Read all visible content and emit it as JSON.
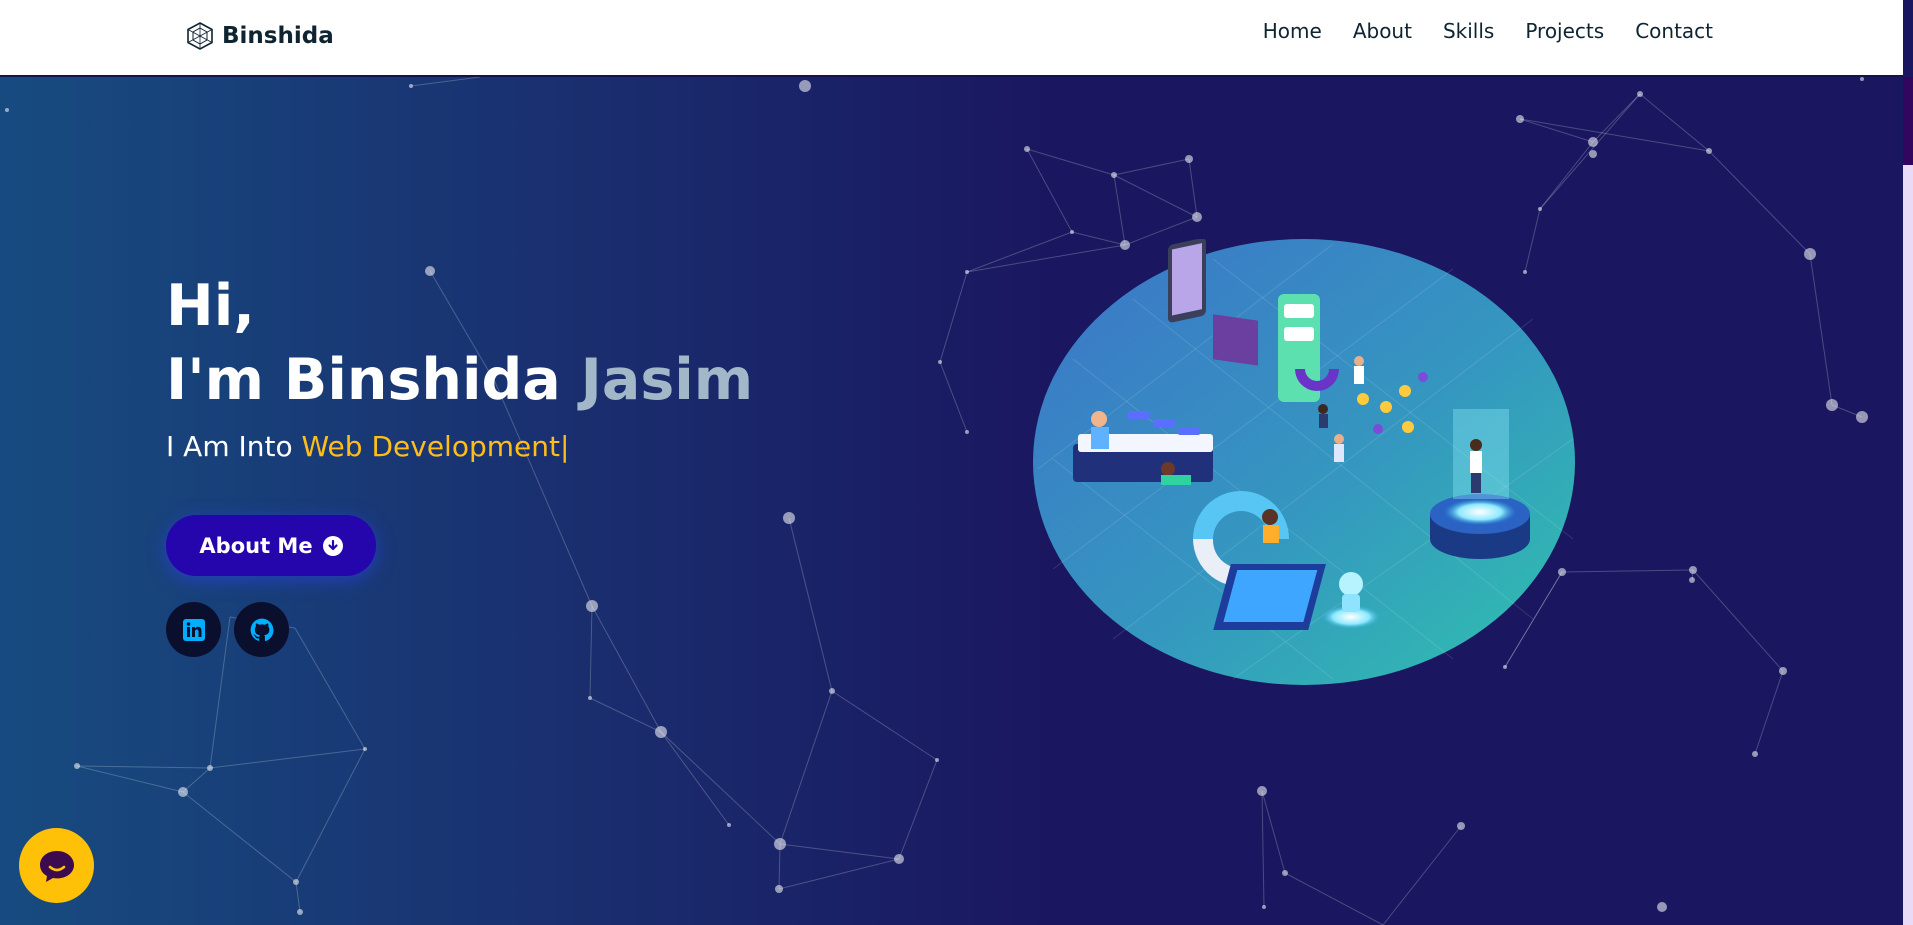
{
  "navbar": {
    "brand": "Binshida",
    "links": [
      "Home",
      "About",
      "Skills",
      "Projects",
      "Contact"
    ]
  },
  "hero": {
    "greeting": "Hi,",
    "intro": "I'm Binshida",
    "last_name": "Jasim",
    "subtitle_prefix": "I Am Into",
    "subtitle_typed": "Web Development",
    "cursor": "|",
    "cta_label": "About Me"
  },
  "social": [
    {
      "icon": "linkedin-icon"
    },
    {
      "icon": "github-icon"
    }
  ],
  "colors": {
    "nav_bg": "#ffffff",
    "hero_bg": "#1a1760",
    "accent_yellow": "#ffbd1a",
    "button_bg": "#2506ad",
    "name_accent": "#a2b8c9",
    "social_icon": "#00aeff",
    "chat_bg": "#ffc107"
  }
}
